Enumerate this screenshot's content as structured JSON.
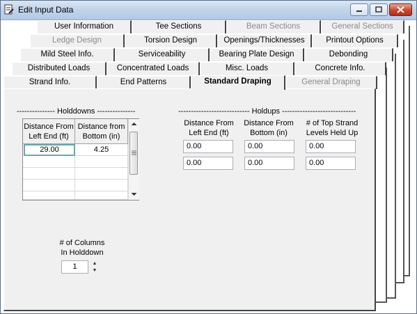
{
  "window": {
    "title": "Edit Input Data"
  },
  "tabs": {
    "row1": [
      {
        "label": "User Information",
        "grey": false
      },
      {
        "label": "Tee Sections",
        "grey": false
      },
      {
        "label": "Beam Sections",
        "grey": true
      },
      {
        "label": "General Sections",
        "grey": true
      }
    ],
    "row2": [
      {
        "label": "Ledge Design",
        "grey": true
      },
      {
        "label": "Torsion Design",
        "grey": false
      },
      {
        "label": "Openings/Thicknesses",
        "grey": false
      },
      {
        "label": "Printout Options",
        "grey": false
      }
    ],
    "row3": [
      {
        "label": "Mild Steel Info.",
        "grey": false
      },
      {
        "label": "Serviceability",
        "grey": false
      },
      {
        "label": "Bearing Plate Design",
        "grey": false
      },
      {
        "label": "Debonding",
        "grey": false
      }
    ],
    "row4": [
      {
        "label": "Distributed Loads",
        "grey": false
      },
      {
        "label": "Concentrated Loads",
        "grey": false
      },
      {
        "label": "Misc. Loads",
        "grey": false
      },
      {
        "label": "Concrete Info.",
        "grey": false
      }
    ],
    "row5": [
      {
        "label": "Strand Info.",
        "grey": false
      },
      {
        "label": "End Patterns",
        "grey": false
      },
      {
        "label": "Standard Draping",
        "grey": false
      },
      {
        "label": "General Draping",
        "grey": true
      }
    ]
  },
  "holddowns": {
    "title": "--------------- Holddowns ---------------",
    "col1": "Distance From\nLeft End (ft)",
    "col2": "Distance from\nBottom (in)",
    "rows": [
      [
        "29.00",
        "4.25"
      ]
    ],
    "columns_label": "# of Columns\nIn Holddown",
    "columns_value": "1"
  },
  "holdups": {
    "title": "---------------------------- Holdups -----------------------------",
    "col1": "Distance From\nLeft End (ft)",
    "col2": "Distance From\nBottom (in)",
    "col3": "# of Top Strand\nLevels Held Up",
    "rows": [
      [
        "0.00",
        "0.00",
        "0.00"
      ],
      [
        "0.00",
        "0.00",
        "0.00"
      ]
    ]
  }
}
